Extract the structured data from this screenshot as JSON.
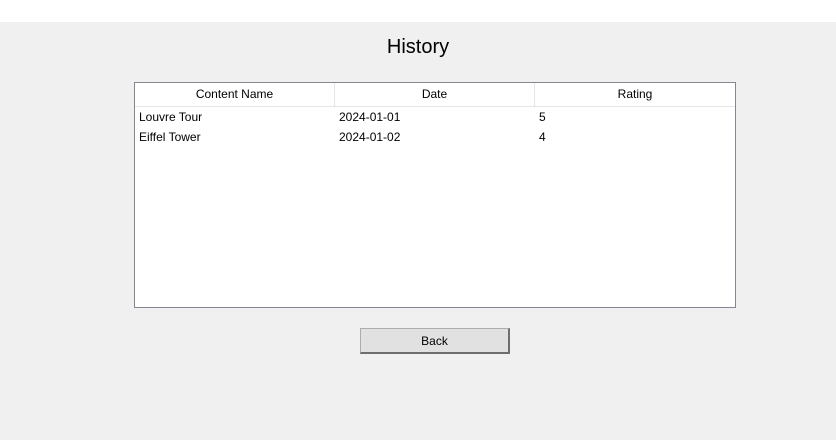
{
  "window": {
    "title": "History"
  },
  "table": {
    "columns": [
      "Content Name",
      "Date",
      "Rating"
    ],
    "rows": [
      [
        "Louvre Tour",
        "2024-01-01",
        "5"
      ],
      [
        "Eiffel Tower",
        "2024-01-02",
        "4"
      ]
    ]
  },
  "actions": {
    "back_label": "Back"
  }
}
